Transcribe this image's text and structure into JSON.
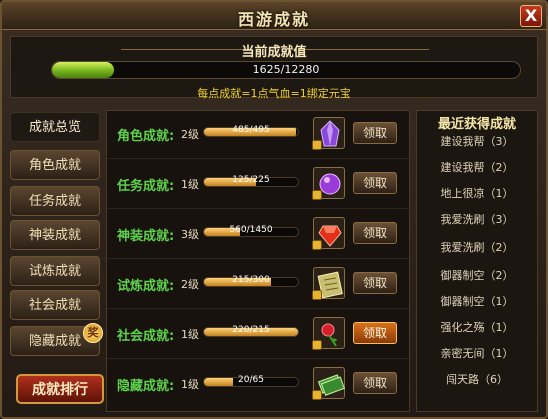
{
  "window": {
    "title": "西游成就",
    "close_label": "X"
  },
  "header": {
    "label": "当前成就值",
    "progress_text": "1625/12280",
    "progress_fraction": 0.1323,
    "subtitle": "每点成就=1点气血=1绑定元宝"
  },
  "nav": {
    "tabs": [
      {
        "label": "成就总览",
        "active": true
      },
      {
        "label": "角色成就",
        "active": false
      },
      {
        "label": "任务成就",
        "active": false
      },
      {
        "label": "神装成就",
        "active": false
      },
      {
        "label": "试炼成就",
        "active": false
      },
      {
        "label": "社会成就",
        "active": false
      },
      {
        "label": "隐藏成就",
        "active": false
      }
    ],
    "hidden_badge": "奖",
    "rank_label": "成就排行"
  },
  "achievements": [
    {
      "name": "角色成就:",
      "level": "2级",
      "progress": "485/495",
      "fraction": 0.98,
      "icon": "purple-crystal-icon",
      "claim": "领取",
      "claim_hot": false
    },
    {
      "name": "任务成就:",
      "level": "1级",
      "progress": "125/225",
      "fraction": 0.556,
      "icon": "purple-gem-icon",
      "claim": "领取",
      "claim_hot": false
    },
    {
      "name": "神装成就:",
      "level": "3级",
      "progress": "560/1450",
      "fraction": 0.386,
      "icon": "red-gem-icon",
      "claim": "领取",
      "claim_hot": false
    },
    {
      "name": "试炼成就:",
      "level": "2级",
      "progress": "215/300",
      "fraction": 0.717,
      "icon": "scroll-icon",
      "claim": "领取",
      "claim_hot": false
    },
    {
      "name": "社会成就:",
      "level": "1级",
      "progress": "220/215",
      "fraction": 1.0,
      "icon": "rose-icon",
      "claim": "领取",
      "claim_hot": true
    },
    {
      "name": "隐藏成就:",
      "level": "1级",
      "progress": "20/65",
      "fraction": 0.308,
      "icon": "money-icon",
      "claim": "领取",
      "claim_hot": false
    }
  ],
  "recent": {
    "title": "最近获得成就",
    "items": [
      "建设我帮（3）",
      "建设我帮（2）",
      "地上很凉（1）",
      "我爱洗刷（3）",
      "我爱洗刷（2）",
      "御器制空（2）",
      "御器制空（1）",
      "强化之殇（1）",
      "亲密无间（1）",
      "闯天路（6）"
    ]
  },
  "colors": {
    "accent_green": "#5ed24c",
    "gold": "#f2d22a",
    "progress_green": "#a8d830"
  }
}
